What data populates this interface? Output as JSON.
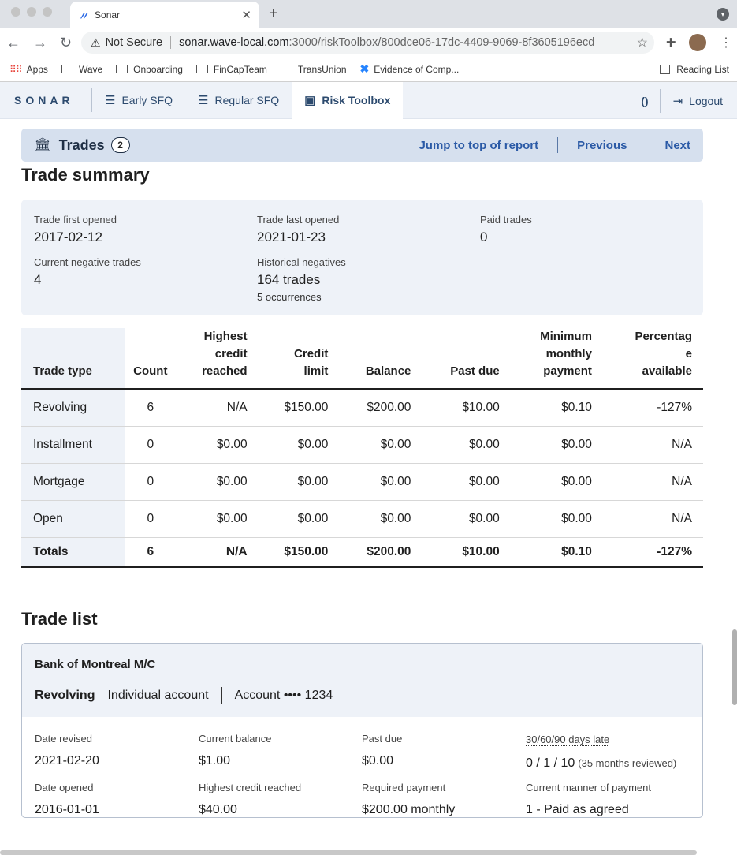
{
  "browser": {
    "tab_title": "Sonar",
    "new_tab": "+",
    "not_secure": "Not Secure",
    "url_host": "sonar.wave-local.com",
    "url_path": ":3000/riskToolbox/800dce06-17dc-4409-9069-8f3605196ecd",
    "bookmarks": [
      "Apps",
      "Wave",
      "Onboarding",
      "FinCapTeam",
      "TransUnion",
      "Evidence of Comp..."
    ],
    "reading_list": "Reading List"
  },
  "app": {
    "logo": "SONAR",
    "nav": [
      "Early SFQ",
      "Regular SFQ",
      "Risk Toolbox"
    ],
    "active_nav": "Risk Toolbox",
    "paren": "()",
    "logout": "Logout"
  },
  "section_bar": {
    "title": "Trades",
    "count": "2",
    "jump": "Jump to top of report",
    "previous": "Previous",
    "next": "Next"
  },
  "trade_summary": {
    "heading": "Trade summary",
    "first_opened_label": "Trade first opened",
    "first_opened": "2017-02-12",
    "last_opened_label": "Trade last opened",
    "last_opened": "2021-01-23",
    "paid_label": "Paid trades",
    "paid": "0",
    "current_neg_label": "Current negative trades",
    "current_neg": "4",
    "hist_neg_label": "Historical negatives",
    "hist_neg": "164 trades",
    "hist_neg_sub": "5 occurrences"
  },
  "table": {
    "headers": {
      "trade_type": "Trade type",
      "count": "Count",
      "highest": [
        "Highest",
        "credit",
        "reached"
      ],
      "limit": [
        "Credit",
        "limit"
      ],
      "balance": "Balance",
      "past_due": "Past due",
      "min_pay": [
        "Minimum",
        "monthly",
        "payment"
      ],
      "pct": [
        "Percentag",
        "e",
        "available"
      ]
    },
    "rows": [
      [
        "Revolving",
        "6",
        "N/A",
        "$150.00",
        "$200.00",
        "$10.00",
        "$0.10",
        "-127%"
      ],
      [
        "Installment",
        "0",
        "$0.00",
        "$0.00",
        "$0.00",
        "$0.00",
        "$0.00",
        "N/A"
      ],
      [
        "Mortgage",
        "0",
        "$0.00",
        "$0.00",
        "$0.00",
        "$0.00",
        "$0.00",
        "N/A"
      ],
      [
        "Open",
        "0",
        "$0.00",
        "$0.00",
        "$0.00",
        "$0.00",
        "$0.00",
        "N/A"
      ]
    ],
    "totals": [
      "Totals",
      "6",
      "N/A",
      "$150.00",
      "$200.00",
      "$10.00",
      "$0.10",
      "-127%"
    ]
  },
  "trade_list": {
    "heading": "Trade list",
    "card": {
      "bank": "Bank of Montreal M/C",
      "type": "Revolving",
      "ownership": "Individual account",
      "account": "Account •••• 1234",
      "date_revised_label": "Date revised",
      "date_revised": "2021-02-20",
      "current_balance_label": "Current balance",
      "current_balance": "$1.00",
      "past_due_label": "Past due",
      "past_due": "$0.00",
      "late_label": "30/60/90 days late",
      "late": "0 / 1 / 10",
      "late_sub": "(35 months reviewed)",
      "date_opened_label": "Date opened",
      "date_opened": "2016-01-01",
      "highest_label": "Highest credit reached",
      "highest": "$40.00",
      "required_label": "Required payment",
      "required": "$200.00 monthly",
      "manner_label": "Current manner of payment",
      "manner": "1 - Paid as agreed"
    }
  }
}
